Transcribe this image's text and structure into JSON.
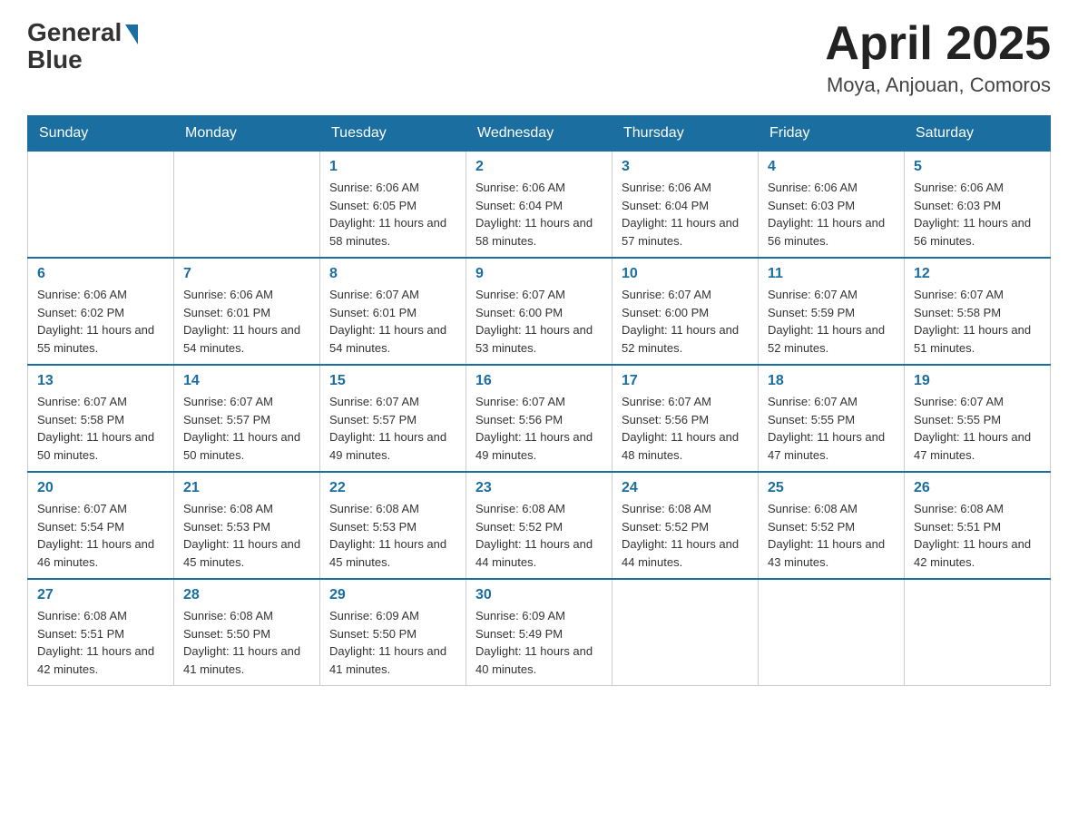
{
  "header": {
    "logo_general": "General",
    "logo_blue": "Blue",
    "month_title": "April 2025",
    "location": "Moya, Anjouan, Comoros"
  },
  "weekdays": [
    "Sunday",
    "Monday",
    "Tuesday",
    "Wednesday",
    "Thursday",
    "Friday",
    "Saturday"
  ],
  "weeks": [
    [
      {
        "day": "",
        "sunrise": "",
        "sunset": "",
        "daylight": ""
      },
      {
        "day": "",
        "sunrise": "",
        "sunset": "",
        "daylight": ""
      },
      {
        "day": "1",
        "sunrise": "Sunrise: 6:06 AM",
        "sunset": "Sunset: 6:05 PM",
        "daylight": "Daylight: 11 hours and 58 minutes."
      },
      {
        "day": "2",
        "sunrise": "Sunrise: 6:06 AM",
        "sunset": "Sunset: 6:04 PM",
        "daylight": "Daylight: 11 hours and 58 minutes."
      },
      {
        "day": "3",
        "sunrise": "Sunrise: 6:06 AM",
        "sunset": "Sunset: 6:04 PM",
        "daylight": "Daylight: 11 hours and 57 minutes."
      },
      {
        "day": "4",
        "sunrise": "Sunrise: 6:06 AM",
        "sunset": "Sunset: 6:03 PM",
        "daylight": "Daylight: 11 hours and 56 minutes."
      },
      {
        "day": "5",
        "sunrise": "Sunrise: 6:06 AM",
        "sunset": "Sunset: 6:03 PM",
        "daylight": "Daylight: 11 hours and 56 minutes."
      }
    ],
    [
      {
        "day": "6",
        "sunrise": "Sunrise: 6:06 AM",
        "sunset": "Sunset: 6:02 PM",
        "daylight": "Daylight: 11 hours and 55 minutes."
      },
      {
        "day": "7",
        "sunrise": "Sunrise: 6:06 AM",
        "sunset": "Sunset: 6:01 PM",
        "daylight": "Daylight: 11 hours and 54 minutes."
      },
      {
        "day": "8",
        "sunrise": "Sunrise: 6:07 AM",
        "sunset": "Sunset: 6:01 PM",
        "daylight": "Daylight: 11 hours and 54 minutes."
      },
      {
        "day": "9",
        "sunrise": "Sunrise: 6:07 AM",
        "sunset": "Sunset: 6:00 PM",
        "daylight": "Daylight: 11 hours and 53 minutes."
      },
      {
        "day": "10",
        "sunrise": "Sunrise: 6:07 AM",
        "sunset": "Sunset: 6:00 PM",
        "daylight": "Daylight: 11 hours and 52 minutes."
      },
      {
        "day": "11",
        "sunrise": "Sunrise: 6:07 AM",
        "sunset": "Sunset: 5:59 PM",
        "daylight": "Daylight: 11 hours and 52 minutes."
      },
      {
        "day": "12",
        "sunrise": "Sunrise: 6:07 AM",
        "sunset": "Sunset: 5:58 PM",
        "daylight": "Daylight: 11 hours and 51 minutes."
      }
    ],
    [
      {
        "day": "13",
        "sunrise": "Sunrise: 6:07 AM",
        "sunset": "Sunset: 5:58 PM",
        "daylight": "Daylight: 11 hours and 50 minutes."
      },
      {
        "day": "14",
        "sunrise": "Sunrise: 6:07 AM",
        "sunset": "Sunset: 5:57 PM",
        "daylight": "Daylight: 11 hours and 50 minutes."
      },
      {
        "day": "15",
        "sunrise": "Sunrise: 6:07 AM",
        "sunset": "Sunset: 5:57 PM",
        "daylight": "Daylight: 11 hours and 49 minutes."
      },
      {
        "day": "16",
        "sunrise": "Sunrise: 6:07 AM",
        "sunset": "Sunset: 5:56 PM",
        "daylight": "Daylight: 11 hours and 49 minutes."
      },
      {
        "day": "17",
        "sunrise": "Sunrise: 6:07 AM",
        "sunset": "Sunset: 5:56 PM",
        "daylight": "Daylight: 11 hours and 48 minutes."
      },
      {
        "day": "18",
        "sunrise": "Sunrise: 6:07 AM",
        "sunset": "Sunset: 5:55 PM",
        "daylight": "Daylight: 11 hours and 47 minutes."
      },
      {
        "day": "19",
        "sunrise": "Sunrise: 6:07 AM",
        "sunset": "Sunset: 5:55 PM",
        "daylight": "Daylight: 11 hours and 47 minutes."
      }
    ],
    [
      {
        "day": "20",
        "sunrise": "Sunrise: 6:07 AM",
        "sunset": "Sunset: 5:54 PM",
        "daylight": "Daylight: 11 hours and 46 minutes."
      },
      {
        "day": "21",
        "sunrise": "Sunrise: 6:08 AM",
        "sunset": "Sunset: 5:53 PM",
        "daylight": "Daylight: 11 hours and 45 minutes."
      },
      {
        "day": "22",
        "sunrise": "Sunrise: 6:08 AM",
        "sunset": "Sunset: 5:53 PM",
        "daylight": "Daylight: 11 hours and 45 minutes."
      },
      {
        "day": "23",
        "sunrise": "Sunrise: 6:08 AM",
        "sunset": "Sunset: 5:52 PM",
        "daylight": "Daylight: 11 hours and 44 minutes."
      },
      {
        "day": "24",
        "sunrise": "Sunrise: 6:08 AM",
        "sunset": "Sunset: 5:52 PM",
        "daylight": "Daylight: 11 hours and 44 minutes."
      },
      {
        "day": "25",
        "sunrise": "Sunrise: 6:08 AM",
        "sunset": "Sunset: 5:52 PM",
        "daylight": "Daylight: 11 hours and 43 minutes."
      },
      {
        "day": "26",
        "sunrise": "Sunrise: 6:08 AM",
        "sunset": "Sunset: 5:51 PM",
        "daylight": "Daylight: 11 hours and 42 minutes."
      }
    ],
    [
      {
        "day": "27",
        "sunrise": "Sunrise: 6:08 AM",
        "sunset": "Sunset: 5:51 PM",
        "daylight": "Daylight: 11 hours and 42 minutes."
      },
      {
        "day": "28",
        "sunrise": "Sunrise: 6:08 AM",
        "sunset": "Sunset: 5:50 PM",
        "daylight": "Daylight: 11 hours and 41 minutes."
      },
      {
        "day": "29",
        "sunrise": "Sunrise: 6:09 AM",
        "sunset": "Sunset: 5:50 PM",
        "daylight": "Daylight: 11 hours and 41 minutes."
      },
      {
        "day": "30",
        "sunrise": "Sunrise: 6:09 AM",
        "sunset": "Sunset: 5:49 PM",
        "daylight": "Daylight: 11 hours and 40 minutes."
      },
      {
        "day": "",
        "sunrise": "",
        "sunset": "",
        "daylight": ""
      },
      {
        "day": "",
        "sunrise": "",
        "sunset": "",
        "daylight": ""
      },
      {
        "day": "",
        "sunrise": "",
        "sunset": "",
        "daylight": ""
      }
    ]
  ]
}
